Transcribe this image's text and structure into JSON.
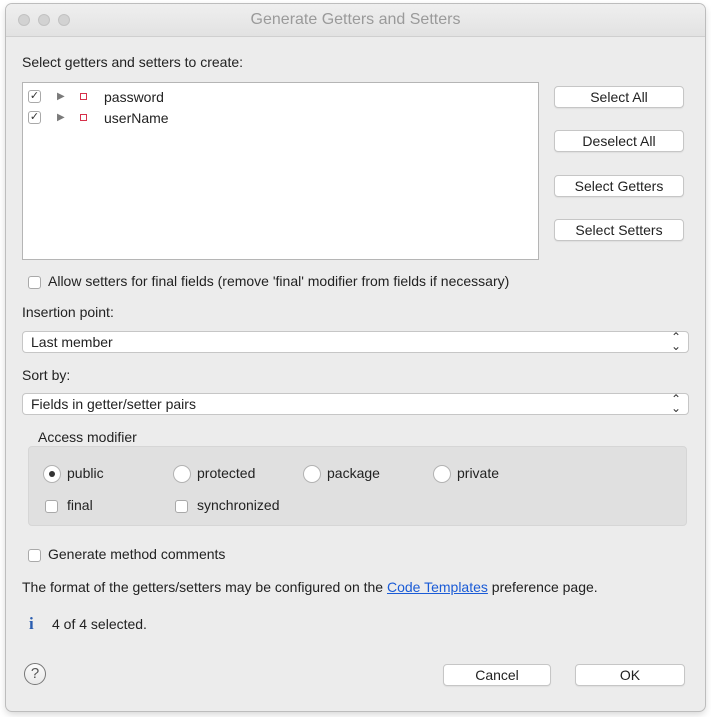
{
  "window": {
    "title": "Generate Getters and Setters"
  },
  "tree": {
    "heading": "Select getters and setters to create:",
    "items": [
      {
        "label": "password",
        "checked": true
      },
      {
        "label": "userName",
        "checked": true
      }
    ]
  },
  "side_buttons": {
    "select_all": "Select All",
    "deselect_all": "Deselect All",
    "select_getters": "Select Getters",
    "select_setters": "Select Setters"
  },
  "allow_setters": {
    "label": "Allow setters for final fields (remove 'final' modifier from fields if necessary)",
    "checked": false
  },
  "insertion_point": {
    "label": "Insertion point:",
    "value": "Last member"
  },
  "sort_by": {
    "label": "Sort by:",
    "value": "Fields in getter/setter pairs"
  },
  "access_modifier": {
    "label": "Access modifier",
    "options": [
      "public",
      "protected",
      "package",
      "private"
    ],
    "selected": "public",
    "final_label": "final",
    "synchronized_label": "synchronized"
  },
  "generate_comments": {
    "label": "Generate method comments",
    "checked": false
  },
  "info": {
    "prefix": "The format of the getters/setters may be configured on the ",
    "link": "Code Templates",
    "suffix": " preference page."
  },
  "status": {
    "icon": "info-icon",
    "text": "4 of 4 selected."
  },
  "footer": {
    "help": "?",
    "cancel": "Cancel",
    "ok": "OK"
  }
}
